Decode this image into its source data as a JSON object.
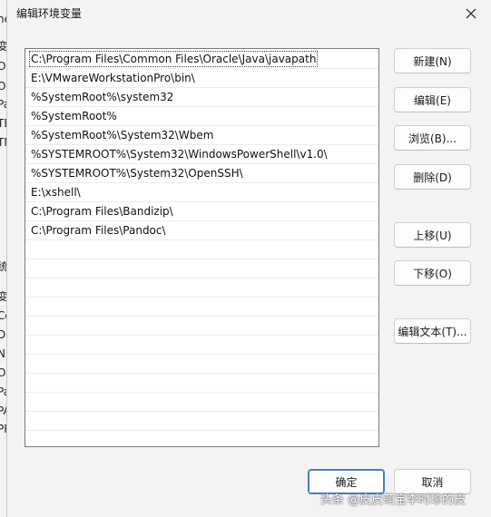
{
  "background_window": {
    "fragments": [
      "ne",
      "变",
      "Or",
      "On",
      "Pa",
      "TE",
      "TM",
      "统",
      "变",
      "Co",
      "Dr",
      "NI",
      "OS",
      "Pa",
      "PA",
      "PF"
    ]
  },
  "dialog": {
    "title": "编辑环境变量",
    "close_icon": "close-icon"
  },
  "path_list": {
    "items": [
      "C:\\Program Files\\Common Files\\Oracle\\Java\\javapath",
      "E:\\VMwareWorkstationPro\\bin\\",
      "%SystemRoot%\\system32",
      "%SystemRoot%",
      "%SystemRoot%\\System32\\Wbem",
      "%SYSTEMROOT%\\System32\\WindowsPowerShell\\v1.0\\",
      "%SYSTEMROOT%\\System32\\OpenSSH\\",
      "E:\\xshell\\",
      "C:\\Program Files\\Bandizip\\",
      "C:\\Program Files\\Pandoc\\"
    ],
    "empty_rows": 11
  },
  "buttons": {
    "new": "新建(N)",
    "edit": "编辑(E)",
    "browse": "浏览(B)...",
    "delete": "删除(D)",
    "move_up": "上移(U)",
    "move_down": "下移(O)",
    "edit_text": "编辑文本(T)...",
    "ok": "确定",
    "cancel": "取消"
  },
  "watermark": "头条 @皮皮萌宝李时珍的皮",
  "colors": {
    "dialog_bg": "#f3f3f3",
    "list_bg": "#ffffff",
    "primary_border": "#4a7cc2"
  }
}
